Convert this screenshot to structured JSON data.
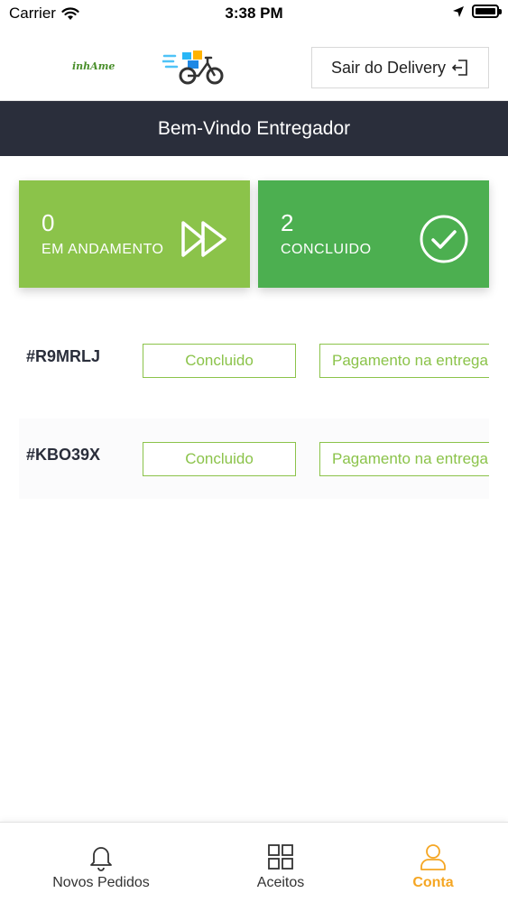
{
  "status_bar": {
    "carrier": "Carrier",
    "time": "3:38 PM"
  },
  "header": {
    "logo_text": "inhAme",
    "exit_button_label": "Sair do Delivery"
  },
  "welcome": {
    "title": "Bem-Vindo Entregador"
  },
  "stats": {
    "in_progress": {
      "count": "0",
      "label": "EM ANDAMENTO",
      "icon": "fast-forward-icon",
      "color": "#8bc34a"
    },
    "completed": {
      "count": "2",
      "label": "CONCLUIDO",
      "icon": "check-circle-icon",
      "color": "#4caf50"
    }
  },
  "orders": [
    {
      "id": "#R9MRLJ",
      "status": "Concluido",
      "payment": "Pagamento na entrega"
    },
    {
      "id": "#KBO39X",
      "status": "Concluido",
      "payment": "Pagamento na entrega"
    }
  ],
  "tab_bar": {
    "items": [
      {
        "label": "Novos Pedidos",
        "icon": "bell-icon"
      },
      {
        "label": "Aceitos",
        "icon": "grid-icon"
      },
      {
        "label": "Conta",
        "icon": "user-icon",
        "active": true
      }
    ],
    "active_color": "#f5a623"
  },
  "colors": {
    "banner": "#2a2e3b",
    "accent_green": "#8bc34a"
  }
}
